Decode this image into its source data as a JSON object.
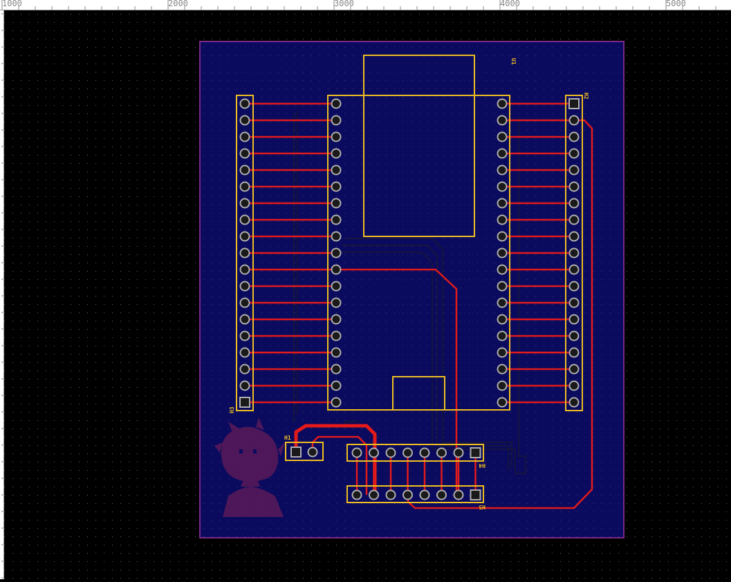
{
  "ruler": {
    "labels": [
      "1000",
      "2000",
      "3000",
      "4000",
      "5000"
    ]
  },
  "board": {
    "designators": {
      "u1": "U1",
      "h1": "H1",
      "h2": "H2",
      "h3": "H3",
      "h4": "H4",
      "h5": "H5"
    },
    "pins_per_side": 19,
    "header_pins": 8,
    "colors": {
      "background": "#000000",
      "board_fill": "#0a0a5e",
      "board_outline": "#7a2a8a",
      "silkscreen": "#f0c020",
      "top_copper": "#e31a1a",
      "bottom_copper": "#1a1a1a",
      "pad_ring": "#b0b0b0",
      "grid_dot": "#6a6a6a"
    },
    "logo": "anime-character-silhouette"
  }
}
